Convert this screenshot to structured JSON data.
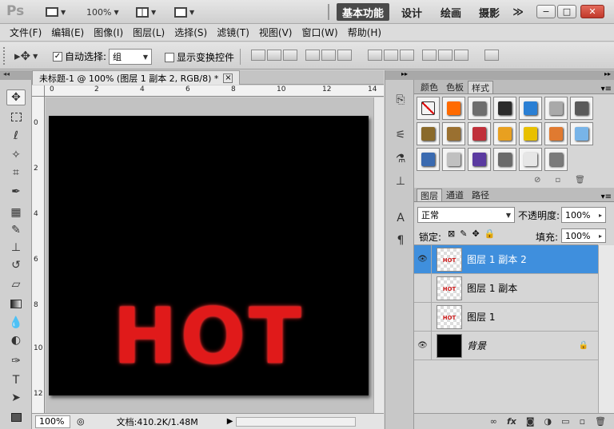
{
  "app": {
    "logo": "Ps",
    "zoom": "100%"
  },
  "workspaces": {
    "basic": "基本功能",
    "design": "设计",
    "painting": "绘画",
    "photography": "摄影",
    "more": "≫"
  },
  "window_buttons": {
    "minimize": "−",
    "restore": "□",
    "close": "✕"
  },
  "menu": [
    "文件(F)",
    "编辑(E)",
    "图像(I)",
    "图层(L)",
    "选择(S)",
    "滤镜(T)",
    "视图(V)",
    "窗口(W)",
    "帮助(H)"
  ],
  "options": {
    "auto_select_label": "自动选择:",
    "auto_select_checked": "✓",
    "auto_select_value": "组",
    "show_transform_label": "显示变换控件"
  },
  "document": {
    "tab_title": "未标题-1 @ 100% (图层 1 副本 2, RGB/8) *",
    "close": "×",
    "canvas_text": "HOT",
    "ruler_h": [
      "0",
      "2",
      "4",
      "6",
      "8",
      "10",
      "12",
      "14"
    ],
    "ruler_v": [
      "0",
      "2",
      "4",
      "6",
      "8",
      "10",
      "12"
    ],
    "zoom": "100%",
    "doc_info": "文档:410.2K/1.48M"
  },
  "style_panel": {
    "tabs": [
      "颜色",
      "色板",
      "样式"
    ],
    "active_tab": "样式",
    "swatches": [
      "#ffffff",
      "#ff6a00",
      "#6d6d6d",
      "#2b2b2b",
      "#2a7fd4",
      "#a9a9a9",
      "#5a5a5a",
      "#8a6a2a",
      "#9a7030",
      "#c0303a",
      "#e8a020",
      "#e8c000",
      "#e07a30",
      "#78b4e8",
      "#3a6ab0",
      "#c0c0c0",
      "#5a3aa0",
      "#6a6a6a",
      "#e6e6e6",
      "#7a7a7a"
    ]
  },
  "layers_panel": {
    "tabs": [
      "图层",
      "通道",
      "路径"
    ],
    "active_tab": "图层",
    "blend_mode": "正常",
    "opacity_label": "不透明度:",
    "opacity": "100%",
    "lock_label": "锁定:",
    "fill_label": "填充:",
    "fill": "100%",
    "layers": [
      {
        "name": "图层 1 副本 2",
        "visible": true,
        "selected": true,
        "thumb_text": "HOT"
      },
      {
        "name": "图层 1 副本",
        "visible": false,
        "selected": false,
        "thumb_text": "HOT"
      },
      {
        "name": "图层 1",
        "visible": false,
        "selected": false,
        "thumb_text": "HOT"
      },
      {
        "name": "背景",
        "visible": true,
        "selected": false,
        "thumb_text": ""
      }
    ],
    "footer_fx": "fx"
  },
  "colors": {
    "selected": "#3f8fdd",
    "text_red": "#e01a1a",
    "canvas": "#000000"
  }
}
